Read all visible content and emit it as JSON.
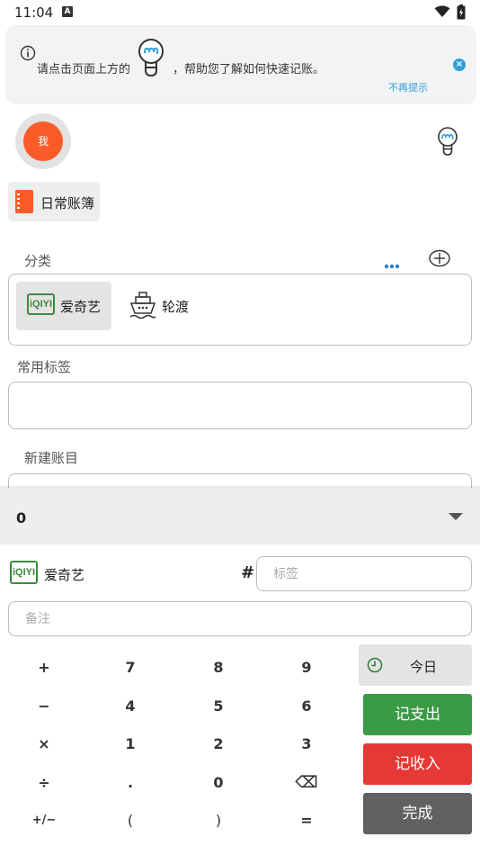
{
  "status_bar": {
    "time": "11:04",
    "notification_letter": "A"
  },
  "tip": {
    "text_before": "请点击页面上方的",
    "text_after": "，帮助您了解如何快速记账。",
    "dismiss": "不再提示",
    "close_symbol": "×"
  },
  "user": {
    "avatar_text": "我"
  },
  "book": {
    "name": "日常账簿"
  },
  "category_section": {
    "label": "分类",
    "more_symbol": "•••",
    "items": [
      {
        "label": "爱奇艺",
        "logo_text": "iQIYI",
        "selected": true
      },
      {
        "label": "轮渡",
        "icon": "ferry-icon",
        "selected": false
      }
    ]
  },
  "tags_section": {
    "label": "常用标签"
  },
  "new_account_section": {
    "label": "新建账目"
  },
  "entry": {
    "amount": "0",
    "category_label": "爱奇艺",
    "category_logo_text": "iQIYI",
    "hash_symbol": "#",
    "tag_placeholder": "标签",
    "note_placeholder": "备注"
  },
  "keypad": {
    "rows": [
      [
        "+",
        "7",
        "8",
        "9"
      ],
      [
        "−",
        "4",
        "5",
        "6"
      ],
      [
        "×",
        "1",
        "2",
        "3"
      ],
      [
        "÷",
        ".",
        "0",
        "⌫"
      ],
      [
        "+/−",
        "(",
        ")",
        "="
      ]
    ]
  },
  "actions": {
    "today": "今日",
    "expense": "记支出",
    "income": "记收入",
    "done": "完成"
  },
  "colors": {
    "avatar": "#fa5b28",
    "expense": "#3a9a45",
    "income": "#e53935",
    "done": "#616161",
    "accent": "#2f9fd8",
    "brand_green": "#3d8a3a"
  }
}
